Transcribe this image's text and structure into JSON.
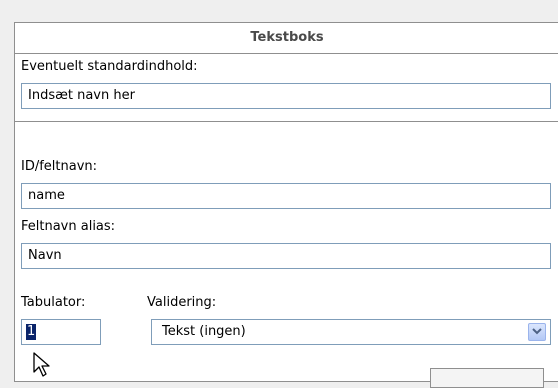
{
  "panel": {
    "title": "Tekstboks",
    "default_content_label": "Eventuelt standardindhold:",
    "default_content_value": "Indsæt navn her",
    "id_label": "ID/feltnavn:",
    "id_value": "name",
    "alias_label": "Feltnavn alias:",
    "alias_value": "Navn",
    "tab_label": "Tabulator:",
    "tab_value": "1",
    "validation_label": "Validering:",
    "validation_value": "Tekst (ingen)"
  },
  "colors": {
    "field_border": "#7f9db9",
    "selection": "#0a246a",
    "dropdown_button": "#c5d6fb"
  },
  "icons": {
    "dropdown": "chevron-down-icon",
    "cursor": "mouse-pointer-icon"
  }
}
